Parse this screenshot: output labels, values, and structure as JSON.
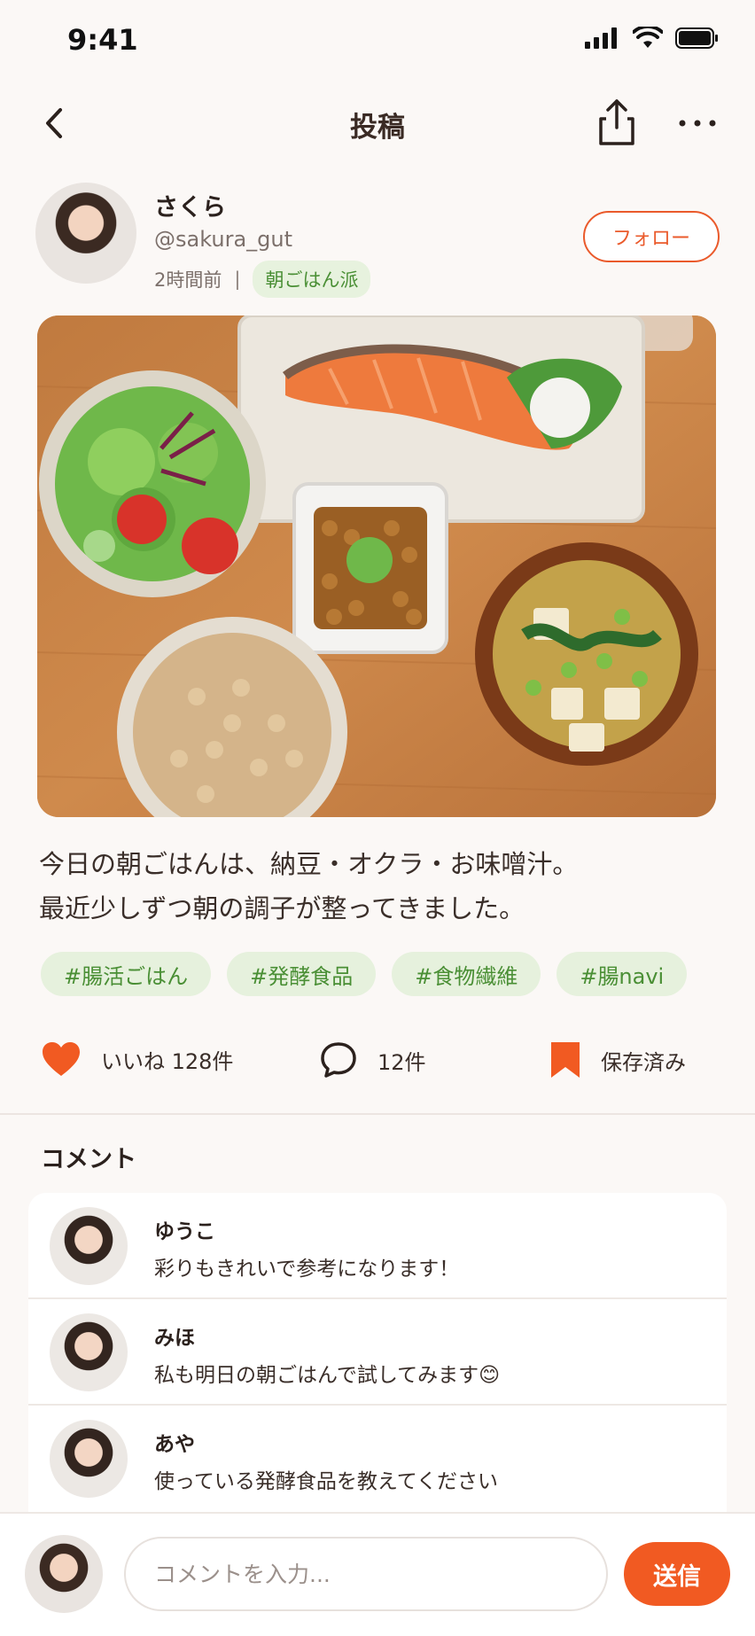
{
  "status_bar": {
    "time": "9:41"
  },
  "nav": {
    "title": "投稿"
  },
  "author": {
    "name": "さくら",
    "handle": "@sakura_gut",
    "posted_ago": "2時間前",
    "separator": "|",
    "badge": "朝ごはん派",
    "follow_label": "フォロー"
  },
  "post": {
    "caption_line1": "今日の朝ごはんは、納豆・オクラ・お味噌汁。",
    "caption_line2": "最近少しずつ朝の調子が整ってきました。",
    "hashtags": [
      "#腸活ごはん",
      "#発酵食品",
      "#食物繊維",
      "#腸navi"
    ]
  },
  "actions": {
    "like_label": "いいね 128件",
    "comment_label": "12件",
    "save_label": "保存済み"
  },
  "comments": {
    "title": "コメント",
    "items": [
      {
        "name": "ゆうこ",
        "text": "彩りもきれいで参考になります！"
      },
      {
        "name": "みほ",
        "text": "私も明日の朝ごはんで試してみます😊"
      },
      {
        "name": "あや",
        "text": "使っている発酵食品を教えてください"
      }
    ]
  },
  "composer": {
    "placeholder": "コメントを入力...",
    "send_label": "送信"
  },
  "colors": {
    "accent": "#f15a22",
    "tag_bg": "#e6f1dd",
    "tag_text": "#4a8f35"
  }
}
